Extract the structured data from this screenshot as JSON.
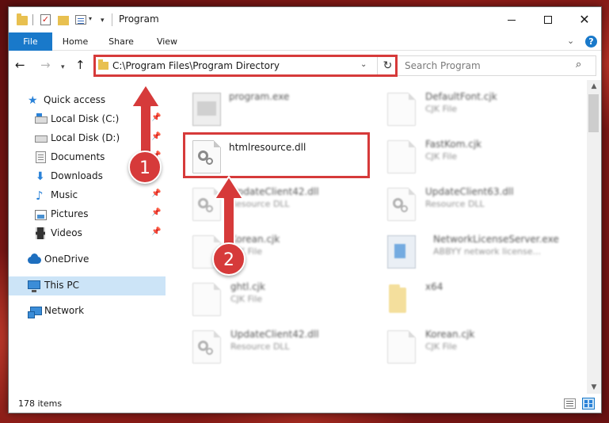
{
  "window": {
    "title": "Program",
    "minimize_glyph": "",
    "close_glyph": "✕"
  },
  "ribbon": {
    "tabs": [
      "File",
      "Home",
      "Share",
      "View"
    ],
    "help_glyph": "?"
  },
  "address": {
    "path": "C:\\Program Files\\Program Directory"
  },
  "search": {
    "placeholder": "Search Program"
  },
  "sidebar": {
    "items": [
      {
        "label": "Quick access",
        "icon": "star-icon"
      },
      {
        "label": "Local Disk (C:)",
        "icon": "drive-icon",
        "pinned": true
      },
      {
        "label": "Local Disk (D:)",
        "icon": "drive-icon",
        "pinned": true
      },
      {
        "label": "Documents",
        "icon": "documents-icon",
        "pinned": true
      },
      {
        "label": "Downloads",
        "icon": "downloads-icon",
        "pinned": true
      },
      {
        "label": "Music",
        "icon": "music-icon",
        "pinned": true
      },
      {
        "label": "Pictures",
        "icon": "pictures-icon",
        "pinned": true
      },
      {
        "label": "Videos",
        "icon": "videos-icon",
        "pinned": true
      },
      {
        "label": "OneDrive",
        "icon": "onedrive-icon"
      },
      {
        "label": "This PC",
        "icon": "pc-icon",
        "selected": true
      },
      {
        "label": "Network",
        "icon": "network-icon"
      }
    ]
  },
  "files": [
    {
      "name": "program.exe",
      "type": "",
      "icon": "exe-icon"
    },
    {
      "name": "DefaultFont.cjk",
      "type": "CJK File",
      "icon": "file-icon"
    },
    {
      "name": "htmlresource.dll",
      "type": "",
      "icon": "dll-icon",
      "highlighted": true
    },
    {
      "name": "FastKom.cjk",
      "type": "CJK File",
      "icon": "file-icon"
    },
    {
      "name": "UpdateClient42.dll",
      "type": "Resource DLL",
      "icon": "dll-icon"
    },
    {
      "name": "UpdateClient63.dll",
      "type": "Resource DLL",
      "icon": "dll-icon"
    },
    {
      "name": "Korean.cjk",
      "type": "CJK File",
      "icon": "file-icon"
    },
    {
      "name": "NetworkLicenseServer.exe",
      "type": "ABBYY network license...",
      "icon": "net-exe-icon"
    },
    {
      "name": "ghtl.cjk",
      "type": "CJK File",
      "icon": "file-icon"
    },
    {
      "name": "x64",
      "type": "",
      "icon": "folder-icon"
    },
    {
      "name": "UpdateClient42.dll",
      "type": "Resource DLL",
      "icon": "dll-icon"
    },
    {
      "name": "Korean.cjk",
      "type": "CJK File",
      "icon": "file-icon"
    }
  ],
  "status": {
    "item_count": "178 items"
  },
  "callouts": [
    {
      "number": "1",
      "target": "address-bar"
    },
    {
      "number": "2",
      "target": "htmlresource.dll"
    }
  ],
  "colors": {
    "accent": "#1979ca",
    "highlight": "#d63a3a",
    "selection": "#cce4f7"
  }
}
